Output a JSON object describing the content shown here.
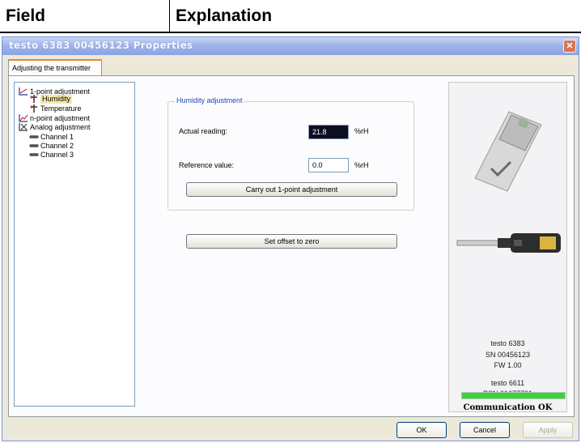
{
  "table_header": {
    "col1": "Field",
    "col2": "Explanation"
  },
  "window": {
    "title": "testo 6383  00456123 Properties",
    "close_label": "✕"
  },
  "tab": {
    "label": "Adjusting the transmitter"
  },
  "tree": {
    "items": [
      {
        "label": "1-point adjustment",
        "icon": "one-point-adjust-icon"
      },
      {
        "label": "Humidity",
        "icon": "probe-icon",
        "selected": true
      },
      {
        "label": "Temperature",
        "icon": "probe-icon"
      },
      {
        "label": "n-point adjustment",
        "icon": "n-point-adjust-icon"
      },
      {
        "label": "Analog adjustment",
        "icon": "analog-adjust-icon"
      },
      {
        "label": "Channel 1",
        "icon": "channel-icon"
      },
      {
        "label": "Channel 2",
        "icon": "channel-icon"
      },
      {
        "label": "Channel 3",
        "icon": "channel-icon"
      }
    ]
  },
  "humidity": {
    "legend": "Humidity adjustment",
    "actual_label": "Actual reading:",
    "actual_value": "21.8",
    "actual_unit": "%rH",
    "reference_label": "Reference value:",
    "reference_value": "0.0",
    "reference_unit": "%rH",
    "adjust_button": "Carry out 1-point adjustment"
  },
  "offset_button": "Set offset to zero",
  "device": {
    "model": "testo 6383",
    "serial": "SN 00456123",
    "firmware": "FW  1.00",
    "probe_model": "testo 6611",
    "probe_serial": "PSN 01677791",
    "status": "Communication OK",
    "progress": 1.0
  },
  "buttons": {
    "ok": "OK",
    "cancel": "Cancel",
    "apply": "Apply"
  },
  "colors": {
    "titlebar": "#9fb4ea",
    "selection": "#f5e9a8",
    "actual_field": "#0d0d22",
    "status_bar": "#3ad43a",
    "tab_accent": "#e68b2c"
  }
}
